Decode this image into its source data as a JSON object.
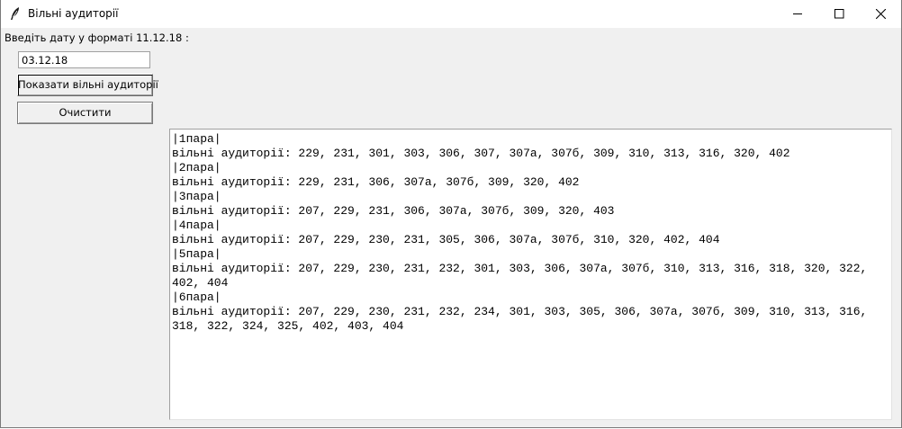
{
  "window": {
    "title": "Вільні аудиторії",
    "icon": "feather-icon",
    "controls": {
      "minimize": "minimize-icon",
      "maximize": "maximize-icon",
      "close": "close-icon"
    }
  },
  "form": {
    "prompt": "Введіть дату у форматі 11.12.18 :",
    "date_value": "03.12.18",
    "show_button": "Показати вільні аудиторії",
    "clear_button": "Очистити"
  },
  "results": {
    "lines": [
      "|1пара|",
      "вільні аудиторії: 229, 231, 301, 303, 306, 307, 307а, 307б, 309, 310, 313, 316, 320, 402",
      "|2пара|",
      "вільні аудиторії: 229, 231, 306, 307а, 307б, 309, 320, 402",
      "|3пара|",
      "вільні аудиторії: 207, 229, 231, 306, 307а, 307б, 309, 320, 403",
      "|4пара|",
      "вільні аудиторії: 207, 229, 230, 231, 305, 306, 307а, 307б, 310, 320, 402, 404",
      "|5пара|",
      "вільні аудиторії: 207, 229, 230, 231, 232, 301, 303, 306, 307а, 307б, 310, 313, 316, 318, 320, 322,",
      "402, 404",
      "|6пара|",
      "вільні аудиторії: 207, 229, 230, 231, 232, 234, 301, 303, 305, 306, 307а, 307б, 309, 310, 313, 316,",
      "318, 322, 324, 325, 402, 403, 404"
    ]
  }
}
